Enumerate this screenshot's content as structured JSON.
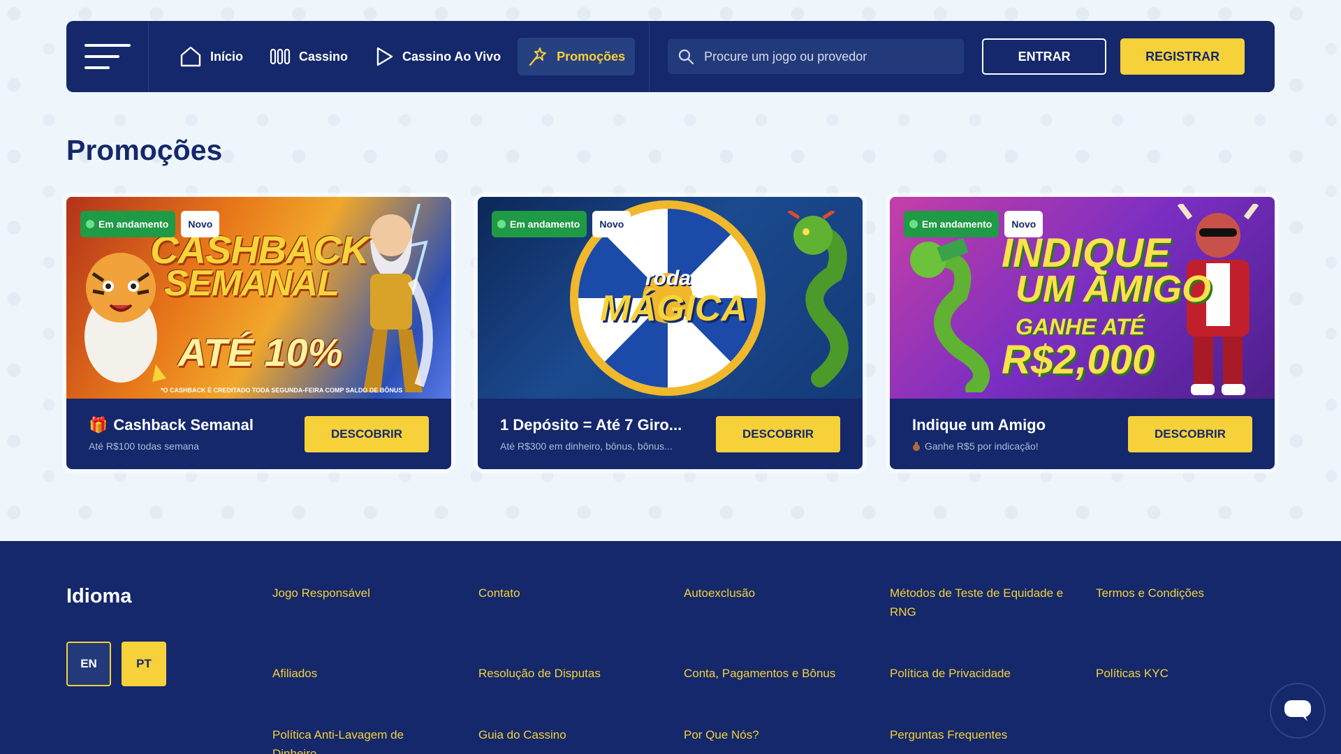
{
  "nav": {
    "items": [
      {
        "label": "Início",
        "icon": "home-icon"
      },
      {
        "label": "Cassino",
        "icon": "slots-icon"
      },
      {
        "label": "Cassino Ao Vivo",
        "icon": "play-icon"
      },
      {
        "label": "Promoções",
        "icon": "sparkle-icon",
        "active": true
      }
    ],
    "search_placeholder": "Procure um jogo ou provedor",
    "login_label": "ENTRAR",
    "register_label": "REGISTRAR"
  },
  "page_title": "Promoções",
  "promotions": [
    {
      "badge_status": "Em andamento",
      "badge_new": "Novo",
      "banner": {
        "line1": "CASHBACK",
        "line2": "SEMANAL",
        "line3": "ATÉ 10%",
        "small": "*O CASHBACK É CREDITADO TODA SEGUNDA-FEIRA COMP SALDO DE BÔNUS"
      },
      "title": "Cashback Semanal",
      "subtitle": "Até R$100 todas semana",
      "button": "DESCOBRIR"
    },
    {
      "badge_status": "Em andamento",
      "badge_new": "Novo",
      "banner": {
        "line1": "roda",
        "line2": "MÁGICA"
      },
      "title": "1 Depósito = Até 7 Giro...",
      "subtitle": "Até R$300 em dinheiro, bônus, bônus...",
      "button": "DESCOBRIR"
    },
    {
      "badge_status": "Em andamento",
      "badge_new": "Novo",
      "banner": {
        "line1": "INDIQUE",
        "line2": "UM AMIGO",
        "line3": "GANHE ATÉ",
        "line4": "R$2,000"
      },
      "title": "Indique um Amigo",
      "subtitle": "Ganhe R$5 por indicação!",
      "button": "DESCOBRIR"
    }
  ],
  "footer": {
    "language_title": "Idioma",
    "languages": [
      "EN",
      "PT"
    ],
    "selected_language": "PT",
    "links": [
      "Jogo Responsável",
      "Contato",
      "Autoexclusão",
      "Métodos de Teste de Equidade e RNG",
      "Termos e Condições",
      "Afiliados",
      "Resolução de Disputas",
      "Conta, Pagamentos e Bônus",
      "Política de Privacidade",
      "Políticas KYC",
      "Política Anti-Lavagem de Dinheiro",
      "Guia do Cassino",
      "Por Que Nós?",
      "Perguntas Frequentes"
    ]
  },
  "colors": {
    "navy": "#14286b",
    "accent_yellow": "#f6d13a",
    "live_green": "#1f9a45",
    "background": "#eef5fb"
  }
}
